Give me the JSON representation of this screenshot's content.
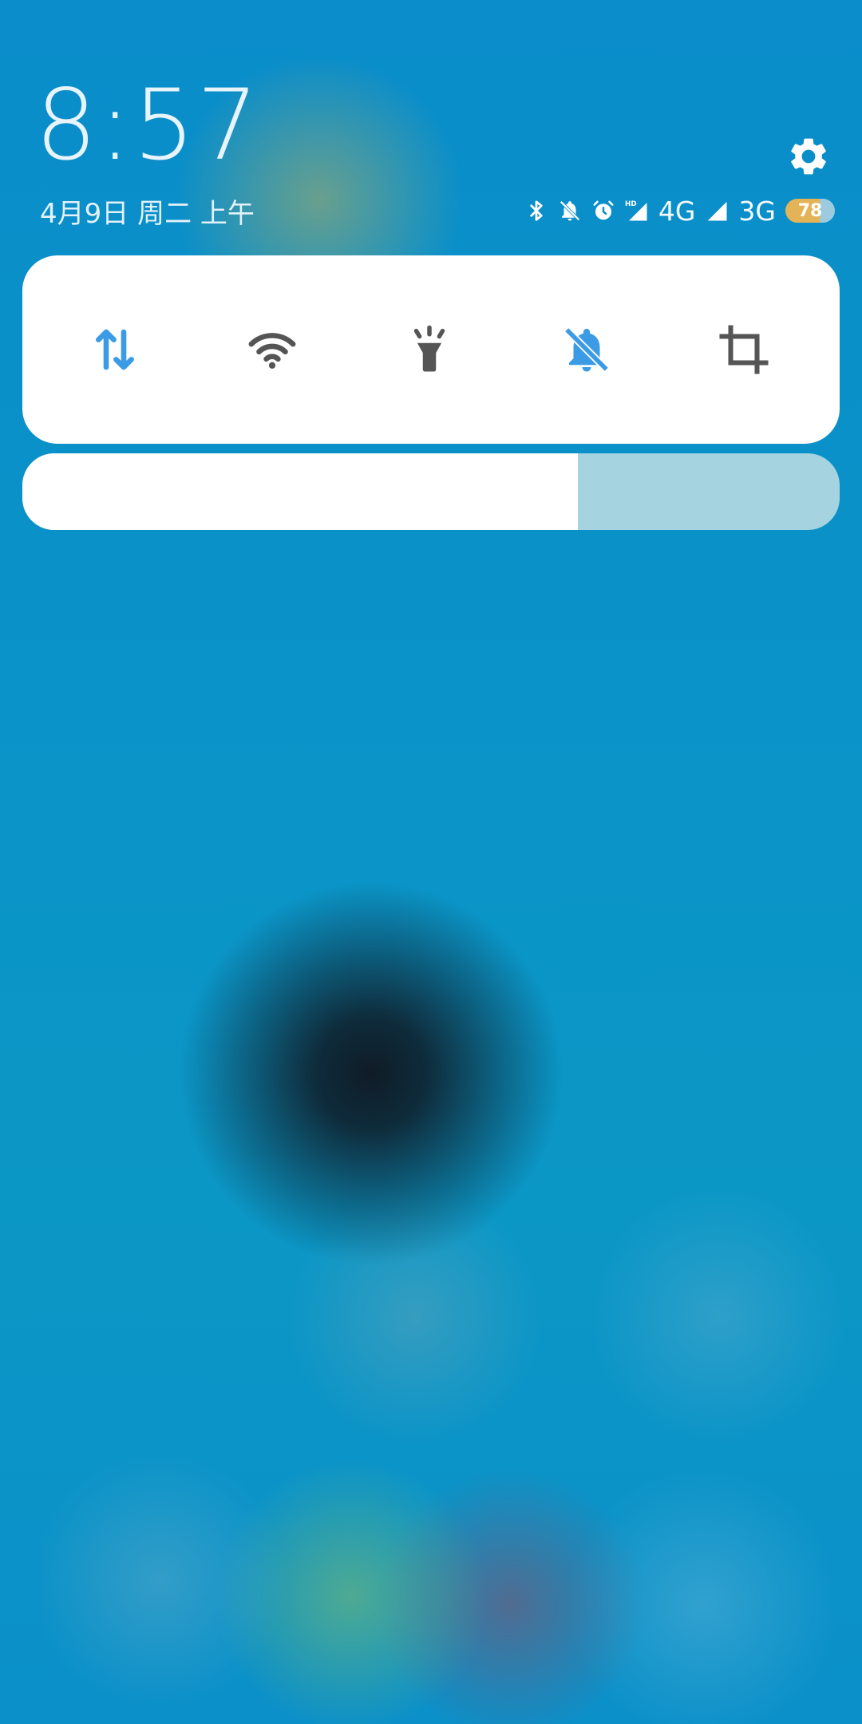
{
  "clock": {
    "time": "8:57"
  },
  "date": {
    "text": "4月9日 周二 上午"
  },
  "status": {
    "network_1": "4G",
    "network_2": "3G",
    "battery": "78",
    "icons": [
      "bluetooth-icon",
      "bell-off-icon",
      "alarm-icon",
      "hd-icon",
      "signal-icon",
      "signal-icon"
    ]
  },
  "quick_settings": {
    "tiles": [
      {
        "name": "mobile-data",
        "icon": "data-arrows-icon",
        "active": true
      },
      {
        "name": "wifi",
        "icon": "wifi-icon",
        "active": false
      },
      {
        "name": "flashlight",
        "icon": "flashlight-icon",
        "active": false
      },
      {
        "name": "silent",
        "icon": "bell-off-icon",
        "active": true
      },
      {
        "name": "screenshot",
        "icon": "crop-icon",
        "active": false
      }
    ],
    "active_color": "#3b9be5",
    "inactive_color": "#555555"
  },
  "brightness": {
    "level": 0.68
  }
}
